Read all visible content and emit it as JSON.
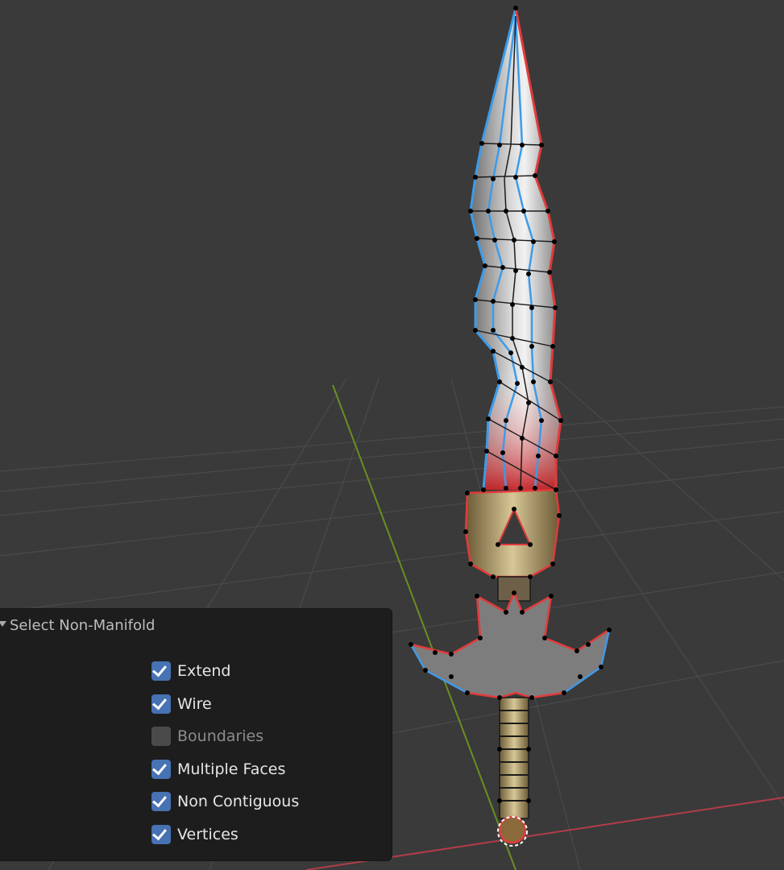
{
  "viewport": {
    "background": "#3a3a3a",
    "x_axis_color": "#b23c4a",
    "y_axis_color": "#6b8e23",
    "edge_select_blue": "#3d9be9",
    "edge_select_red": "#e23b3b"
  },
  "operator_panel": {
    "title": "Select Non-Manifold",
    "options": [
      {
        "label": "Extend",
        "checked": true,
        "enabled": true
      },
      {
        "label": "Wire",
        "checked": true,
        "enabled": true
      },
      {
        "label": "Boundaries",
        "checked": false,
        "enabled": false
      },
      {
        "label": "Multiple Faces",
        "checked": true,
        "enabled": true
      },
      {
        "label": "Non Contiguous",
        "checked": true,
        "enabled": true
      },
      {
        "label": "Vertices",
        "checked": true,
        "enabled": true
      }
    ]
  }
}
